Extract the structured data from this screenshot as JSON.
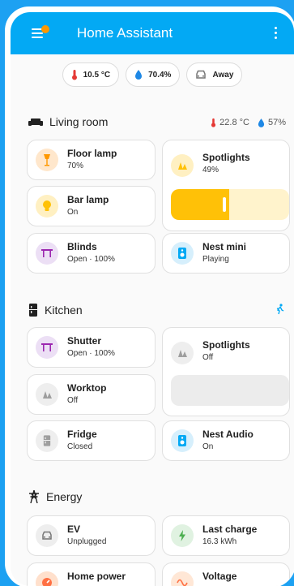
{
  "colors": {
    "accent": "#03a9f4",
    "lamp": "#ff9800",
    "bar_lamp": "#ffc107",
    "blinds": "#9c27b0",
    "speaker": "#03a9f4",
    "charge": "#4caf50",
    "off": "#9e9e9e"
  },
  "header": {
    "title": "Home Assistant"
  },
  "badges": [
    {
      "icon": "thermometer-icon",
      "label": "10.5 °C"
    },
    {
      "icon": "water-drop-icon",
      "label": "70.4%"
    },
    {
      "icon": "car-icon",
      "label": "Away"
    }
  ],
  "living_room": {
    "title": "Living room",
    "temperature": "22.8 °C",
    "humidity": "57%",
    "tiles": {
      "floor_lamp": {
        "name": "Floor lamp",
        "state": "70%"
      },
      "spotlights": {
        "name": "Spotlights",
        "state": "49%",
        "level": 0.49
      },
      "bar_lamp": {
        "name": "Bar lamp",
        "state": "On"
      },
      "blinds": {
        "name": "Blinds",
        "state": "Open · 100%"
      },
      "nest_mini": {
        "name": "Nest mini",
        "state": "Playing"
      }
    }
  },
  "kitchen": {
    "title": "Kitchen",
    "tiles": {
      "shutter": {
        "name": "Shutter",
        "state": "Open · 100%"
      },
      "spotlights": {
        "name": "Spotlights",
        "state": "Off"
      },
      "worktop": {
        "name": "Worktop",
        "state": "Off"
      },
      "fridge": {
        "name": "Fridge",
        "state": "Closed"
      },
      "nest_audio": {
        "name": "Nest Audio",
        "state": "On"
      }
    }
  },
  "energy": {
    "title": "Energy",
    "tiles": {
      "ev": {
        "name": "EV",
        "state": "Unplugged"
      },
      "last_charge": {
        "name": "Last charge",
        "state": "16.3 kWh"
      },
      "home_power": {
        "name": "Home power"
      },
      "voltage": {
        "name": "Voltage"
      }
    }
  }
}
